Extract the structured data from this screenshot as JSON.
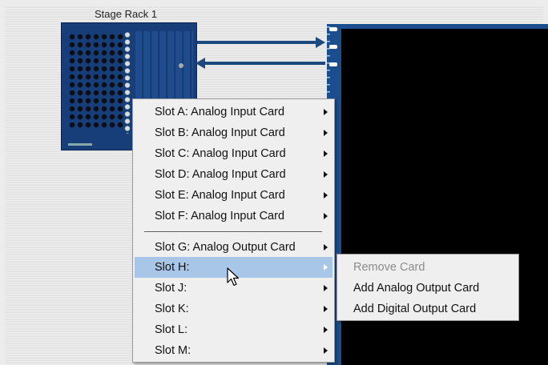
{
  "stage_rack": {
    "title": "Stage Rack 1"
  },
  "context_menu": {
    "items": [
      {
        "label": "Slot A: Analog Input Card"
      },
      {
        "label": "Slot B: Analog Input Card"
      },
      {
        "label": "Slot C: Analog Input Card"
      },
      {
        "label": "Slot D: Analog Input Card"
      },
      {
        "label": "Slot E: Analog Input Card"
      },
      {
        "label": "Slot F: Analog Input Card"
      },
      {
        "label": "Slot G: Analog Output Card"
      },
      {
        "label": "Slot H:",
        "highlighted": true
      },
      {
        "label": "Slot J:"
      },
      {
        "label": "Slot K:"
      },
      {
        "label": "Slot L:"
      },
      {
        "label": "Slot M:"
      }
    ]
  },
  "submenu": {
    "items": [
      {
        "label": "Remove Card",
        "disabled": true
      },
      {
        "label": "Add Analog Output Card"
      },
      {
        "label": "Add Digital Output Card"
      }
    ]
  },
  "colors": {
    "rack_blue": "#173e78",
    "connector_blue": "#1b4e8c",
    "highlight": "#a8c6e8",
    "menu_bg": "#efefef"
  },
  "icons": {
    "cursor": "arrow-pointer-icon",
    "submenu_arrow": "chevron-right-icon"
  }
}
